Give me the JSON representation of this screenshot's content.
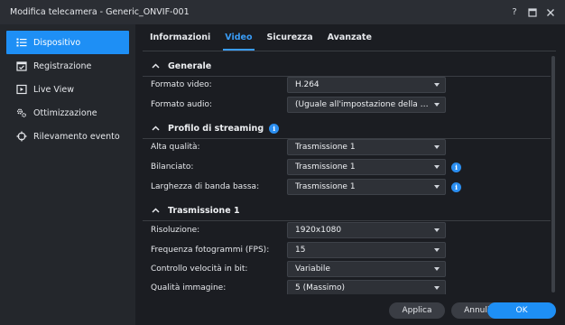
{
  "window": {
    "title": "Modifica telecamera - Generic_ONVIF-001",
    "help": "?",
    "controls": [
      "help",
      "maximize",
      "close"
    ]
  },
  "sidebar": {
    "items": [
      {
        "label": "Dispositivo",
        "icon": "list-icon",
        "active": true
      },
      {
        "label": "Registrazione",
        "icon": "calendar-icon",
        "active": false
      },
      {
        "label": "Live View",
        "icon": "play-icon",
        "active": false
      },
      {
        "label": "Ottimizzazione",
        "icon": "gears-icon",
        "active": false
      },
      {
        "label": "Rilevamento evento",
        "icon": "crosshair-icon",
        "active": false
      }
    ]
  },
  "tabs": [
    {
      "label": "Informazioni",
      "active": false
    },
    {
      "label": "Video",
      "active": true
    },
    {
      "label": "Sicurezza",
      "active": false
    },
    {
      "label": "Avanzate",
      "active": false
    }
  ],
  "sections": {
    "generale": {
      "title": "Generale",
      "rows": [
        {
          "label": "Formato video:",
          "value": "H.264"
        },
        {
          "label": "Formato audio:",
          "value": "(Uguale all'impostazione della telecamera)"
        }
      ]
    },
    "profilo": {
      "title": "Profilo di streaming",
      "rows": [
        {
          "label": "Alta qualità:",
          "value": "Trasmissione 1"
        },
        {
          "label": "Bilanciato:",
          "value": "Trasmissione 1"
        },
        {
          "label": "Larghezza di banda bassa:",
          "value": "Trasmissione 1"
        }
      ]
    },
    "trasmissione": {
      "title": "Trasmissione 1",
      "rows": [
        {
          "label": "Risoluzione:",
          "value": "1920x1080"
        },
        {
          "label": "Frequenza fotogrammi (FPS):",
          "value": "15"
        },
        {
          "label": "Controllo velocità in bit:",
          "value": "Variabile"
        },
        {
          "label": "Qualità immagine:",
          "value": "5 (Massimo)"
        }
      ]
    }
  },
  "info_symbol": "i",
  "footer": {
    "apply": "Applica",
    "cancel": "Annulla",
    "ok": "OK"
  },
  "colors": {
    "accent": "#1e8ff5",
    "background": "#1b1d22",
    "sidebar": "#24272c"
  }
}
